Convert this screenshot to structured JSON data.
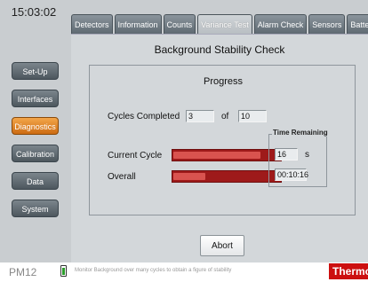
{
  "clock": "15:03:02",
  "tabs": [
    {
      "label": "Detectors"
    },
    {
      "label": "Information"
    },
    {
      "label": "Counts"
    },
    {
      "label": "Variance Test"
    },
    {
      "label": "Alarm Check"
    },
    {
      "label": "Sensors"
    },
    {
      "label": "Battery"
    }
  ],
  "active_tab": "Variance Test",
  "panel": {
    "title": "Background Stability Check",
    "progress_title": "Progress",
    "cycles_label": "Cycles Completed",
    "cycles_completed": "3",
    "of_label": "of",
    "cycles_total": "10",
    "current_cycle_label": "Current Cycle",
    "overall_label": "Overall",
    "current_cycle_progress": 0.82,
    "overall_progress": 0.3,
    "time_remaining_label": "Time Remaining",
    "cycle_seconds": "16",
    "seconds_unit": "s",
    "overall_time": "00:10:16",
    "abort_label": "Abort"
  },
  "nav": [
    {
      "label": "Set-Up"
    },
    {
      "label": "Interfaces"
    },
    {
      "label": "Diagnostics"
    },
    {
      "label": "Calibration"
    },
    {
      "label": "Data"
    },
    {
      "label": "System"
    }
  ],
  "active_nav": "Diagnostics",
  "footer": {
    "model": "PM12",
    "battery_icon": "battery-icon",
    "status": "Monitor Background over many cycles to obtain a figure of stability",
    "brand": "Thermo"
  },
  "colors": {
    "active_nav": "#e8892a",
    "bar_bg": "#9e1a1a",
    "bar_fill": "#d9534f",
    "brand": "#cc1010"
  }
}
